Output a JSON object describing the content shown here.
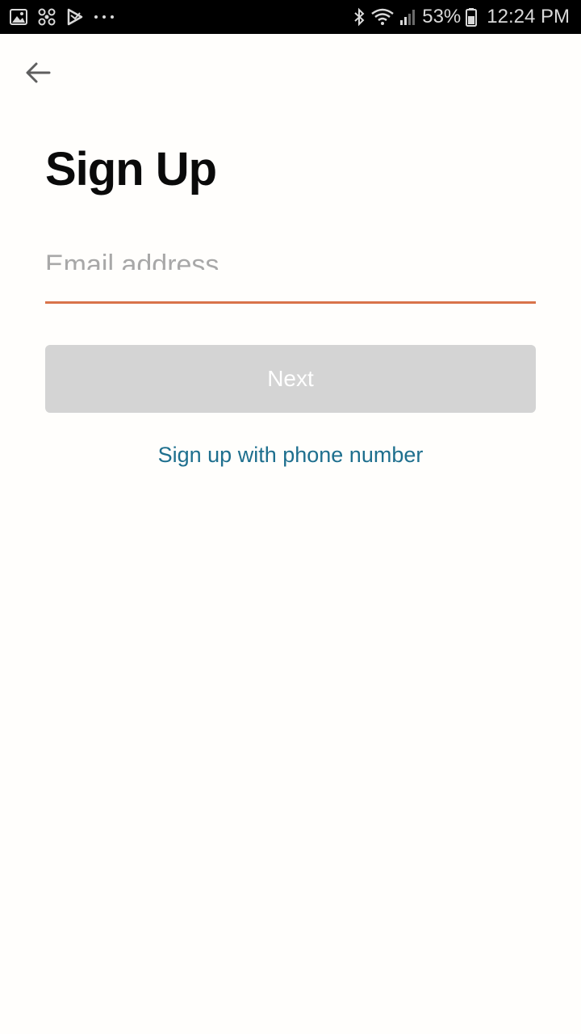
{
  "status_bar": {
    "left_icons": [
      "gallery-icon",
      "fan-icon",
      "play-store-icon",
      "more-dots-icon"
    ],
    "right_icons": [
      "bluetooth-icon",
      "wifi-icon",
      "signal-icon",
      "battery-icon"
    ],
    "battery_percent": "53%",
    "time": "12:24 PM"
  },
  "nav": {
    "back_icon": "arrow-left-icon"
  },
  "page": {
    "title": "Sign Up"
  },
  "form": {
    "email_placeholder": "Email address",
    "email_value": "",
    "next_label": "Next",
    "alt_link_label": "Sign up with phone number"
  },
  "colors": {
    "accent_underline": "#d9734a",
    "link": "#1e6f8e",
    "button_disabled": "#d4d4d4"
  }
}
